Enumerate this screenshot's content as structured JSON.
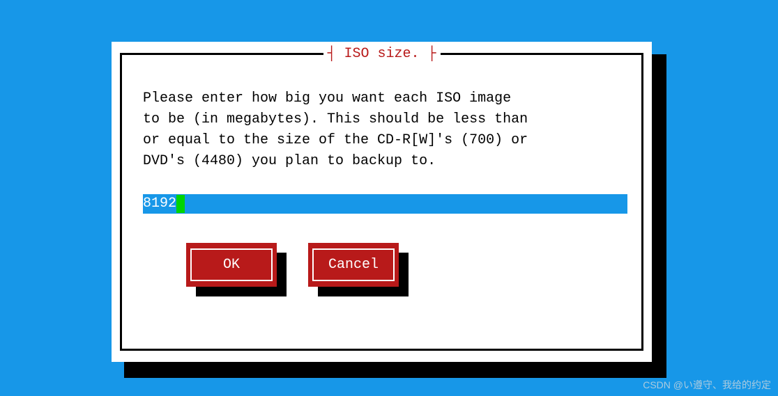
{
  "dialog": {
    "title": "┤ ISO size. ├",
    "prompt": "Please enter how big you want each ISO image\nto be (in megabytes). This should be less than\nor equal to the size of the CD-R[W]'s (700) or\nDVD's (4480) you plan to backup to.",
    "input_value": "8192",
    "buttons": {
      "ok": "OK",
      "cancel": "Cancel"
    }
  },
  "watermark": "CSDN @い遵守、我给的约定"
}
